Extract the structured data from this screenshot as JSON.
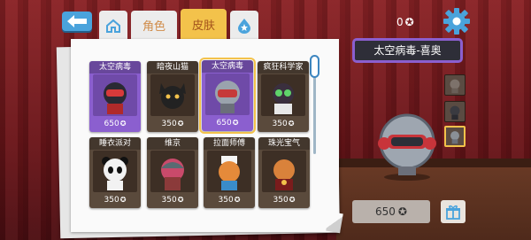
{
  "tabs": {
    "role_label": "角色",
    "skin_label": "皮肤"
  },
  "currency": {
    "amount": "0",
    "gem_symbol": "✪"
  },
  "selected_skin": {
    "name": "太空病毒-喜奥",
    "price": "650",
    "gem_symbol": "✪"
  },
  "cards": [
    {
      "name": "太空病毒",
      "price": "650",
      "owned": true,
      "art": "red-astronaut-robot"
    },
    {
      "name": "暗夜山猫",
      "price": "350",
      "owned": false,
      "art": "dark-cat"
    },
    {
      "name": "太空病毒",
      "price": "650",
      "owned": true,
      "selected": true,
      "art": "silver-helmet-robot"
    },
    {
      "name": "疯狂科学家",
      "price": "350",
      "owned": false,
      "art": "mad-scientist"
    },
    {
      "name": "睡衣派对",
      "price": "350",
      "owned": false,
      "art": "panda-pajama"
    },
    {
      "name": "维京",
      "price": "350",
      "owned": false,
      "art": "viking"
    },
    {
      "name": "拉面师傅",
      "price": "350",
      "owned": false,
      "art": "ramen-chef-dog"
    },
    {
      "name": "珠光宝气",
      "price": "350",
      "owned": false,
      "art": "jeweled-dog"
    }
  ],
  "gem_symbol": "✪",
  "colors": {
    "owned_card": "#8b5fcf",
    "locked_card": "#5a4a3c",
    "active_tab": "#f3c24b",
    "accent_blue": "#4aa3dc"
  }
}
